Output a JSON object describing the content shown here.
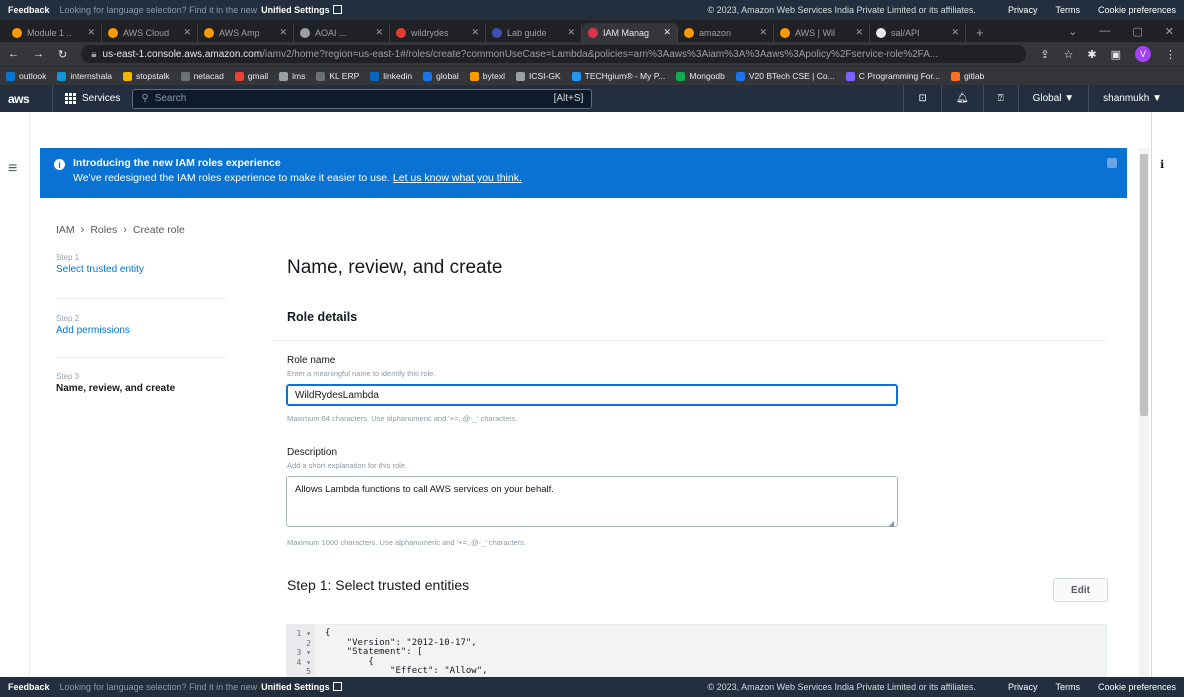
{
  "feedback_bar": {
    "feedback": "Feedback",
    "message_prefix": "Looking for language selection? Find it in the new",
    "message_link": "Unified Settings",
    "copyright": "© 2023, Amazon Web Services India Private Limited or its affiliates.",
    "privacy": "Privacy",
    "terms": "Terms",
    "cookies": "Cookie preferences"
  },
  "browser": {
    "tabs": [
      {
        "label": "Module 1 ..",
        "color": "#ff9900"
      },
      {
        "label": "AWS Cloud",
        "color": "#ff9900"
      },
      {
        "label": "AWS Amp",
        "color": "#ff9900"
      },
      {
        "label": "AOAI ...",
        "color": "#9aa0a6"
      },
      {
        "label": "wildrydes",
        "color": "#e53935"
      },
      {
        "label": "Lab guide",
        "color": "#3f51b5"
      },
      {
        "label": "IAM Manag",
        "color": "#dd344c"
      },
      {
        "label": "amazon",
        "color": "#ff9900"
      },
      {
        "label": "AWS | Wil",
        "color": "#ff9900"
      },
      {
        "label": "sal/API",
        "color": "#e8eaed"
      }
    ],
    "url_host": "us-east-1.console.aws.amazon.com",
    "url_path": "/iamv2/home?region=us-east-1#/roles/create?commonUseCase=Lambda&policies=arn%3Aaws%3Aiam%3A%3Aaws%3Apolicy%2Fservice-role%2FA...",
    "profile_initial": "V",
    "bookmarks": [
      {
        "label": "outlook",
        "color": "#0078d4"
      },
      {
        "label": "internshala",
        "color": "#1295d8"
      },
      {
        "label": "stopstalk",
        "color": "#f4b400"
      },
      {
        "label": "netacad",
        "color": "#6b7075"
      },
      {
        "label": "gmail",
        "color": "#ea4335"
      },
      {
        "label": "lms",
        "color": "#9aa0a6"
      },
      {
        "label": "KL ERP",
        "color": "#6b7075"
      },
      {
        "label": "linkedin",
        "color": "#0a66c2"
      },
      {
        "label": "global",
        "color": "#1a73e8"
      },
      {
        "label": "bytexl",
        "color": "#ff9900"
      },
      {
        "label": "ICSI-GK",
        "color": "#9aa0a6"
      },
      {
        "label": "TECHgium® - My P...",
        "color": "#2196f3"
      },
      {
        "label": "Mongodb",
        "color": "#13aa52"
      },
      {
        "label": "V20 BTech CSE | Co...",
        "color": "#1a73e8"
      },
      {
        "label": "C Programming For...",
        "color": "#7b61ff"
      },
      {
        "label": "gitlab",
        "color": "#fc6d26"
      }
    ]
  },
  "aws_nav": {
    "logo": "aws",
    "services": "Services",
    "search_placeholder": "Search",
    "search_shortcut": "[Alt+S]",
    "region": "Global ▼",
    "user": "shanmukh ▼"
  },
  "banner": {
    "title": "Introducing the new IAM roles experience",
    "text": "We've redesigned the IAM roles experience to make it easier to use.",
    "link": "Let us know what you think."
  },
  "breadcrumb": [
    "IAM",
    "Roles",
    "Create role"
  ],
  "steps": [
    {
      "num": "Step 1",
      "label": "Select trusted entity"
    },
    {
      "num": "Step 2",
      "label": "Add permissions"
    },
    {
      "num": "Step 3",
      "label": "Name, review, and create"
    }
  ],
  "page_title": "Name, review, and create",
  "role_details": {
    "heading": "Role details",
    "role_name_label": "Role name",
    "role_name_desc": "Enter a meaningful name to identify this role.",
    "role_name_value": "WildRydesLambda",
    "role_name_hint": "Maximum 64 characters. Use alphanumeric and '+=,.@-_' characters.",
    "description_label": "Description",
    "description_desc": "Add a short explanation for this role.",
    "description_value": "Allows Lambda functions to call AWS services on your behalf.",
    "description_hint": "Maximum 1000 characters. Use alphanumeric and '+=,.@-_' characters."
  },
  "step1_section": {
    "heading": "Step 1: Select trusted entities",
    "edit": "Edit",
    "line_numbers": [
      "1 ▾",
      "2",
      "3 ▾",
      "4 ▾",
      "5"
    ],
    "code_lines": [
      "{",
      "    \"Version\": \"2012-10-17\",",
      "    \"Statement\": [",
      "        {",
      "            \"Effect\": \"Allow\","
    ]
  }
}
